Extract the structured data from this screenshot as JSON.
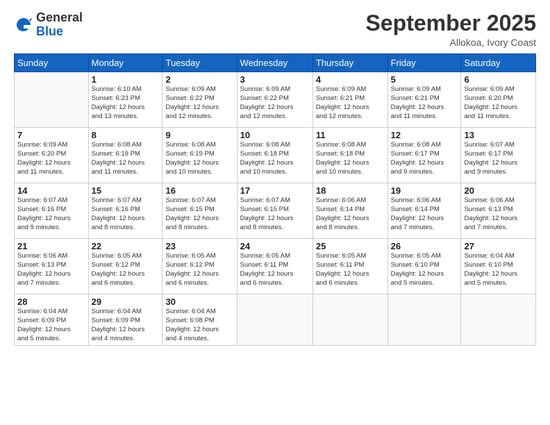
{
  "logo": {
    "general": "General",
    "blue": "Blue"
  },
  "title": "September 2025",
  "location": "Allokoa, Ivory Coast",
  "days_of_week": [
    "Sunday",
    "Monday",
    "Tuesday",
    "Wednesday",
    "Thursday",
    "Friday",
    "Saturday"
  ],
  "weeks": [
    [
      {
        "day": "",
        "info": ""
      },
      {
        "day": "1",
        "info": "Sunrise: 6:10 AM\nSunset: 6:23 PM\nDaylight: 12 hours\nand 13 minutes."
      },
      {
        "day": "2",
        "info": "Sunrise: 6:09 AM\nSunset: 6:22 PM\nDaylight: 12 hours\nand 12 minutes."
      },
      {
        "day": "3",
        "info": "Sunrise: 6:09 AM\nSunset: 6:22 PM\nDaylight: 12 hours\nand 12 minutes."
      },
      {
        "day": "4",
        "info": "Sunrise: 6:09 AM\nSunset: 6:21 PM\nDaylight: 12 hours\nand 12 minutes."
      },
      {
        "day": "5",
        "info": "Sunrise: 6:09 AM\nSunset: 6:21 PM\nDaylight: 12 hours\nand 11 minutes."
      },
      {
        "day": "6",
        "info": "Sunrise: 6:09 AM\nSunset: 6:20 PM\nDaylight: 12 hours\nand 11 minutes."
      }
    ],
    [
      {
        "day": "7",
        "info": "Sunrise: 6:09 AM\nSunset: 6:20 PM\nDaylight: 12 hours\nand 11 minutes."
      },
      {
        "day": "8",
        "info": "Sunrise: 6:08 AM\nSunset: 6:19 PM\nDaylight: 12 hours\nand 11 minutes."
      },
      {
        "day": "9",
        "info": "Sunrise: 6:08 AM\nSunset: 6:19 PM\nDaylight: 12 hours\nand 10 minutes."
      },
      {
        "day": "10",
        "info": "Sunrise: 6:08 AM\nSunset: 6:18 PM\nDaylight: 12 hours\nand 10 minutes."
      },
      {
        "day": "11",
        "info": "Sunrise: 6:08 AM\nSunset: 6:18 PM\nDaylight: 12 hours\nand 10 minutes."
      },
      {
        "day": "12",
        "info": "Sunrise: 6:08 AM\nSunset: 6:17 PM\nDaylight: 12 hours\nand 9 minutes."
      },
      {
        "day": "13",
        "info": "Sunrise: 6:07 AM\nSunset: 6:17 PM\nDaylight: 12 hours\nand 9 minutes."
      }
    ],
    [
      {
        "day": "14",
        "info": "Sunrise: 6:07 AM\nSunset: 6:16 PM\nDaylight: 12 hours\nand 9 minutes."
      },
      {
        "day": "15",
        "info": "Sunrise: 6:07 AM\nSunset: 6:16 PM\nDaylight: 12 hours\nand 8 minutes."
      },
      {
        "day": "16",
        "info": "Sunrise: 6:07 AM\nSunset: 6:15 PM\nDaylight: 12 hours\nand 8 minutes."
      },
      {
        "day": "17",
        "info": "Sunrise: 6:07 AM\nSunset: 6:15 PM\nDaylight: 12 hours\nand 8 minutes."
      },
      {
        "day": "18",
        "info": "Sunrise: 6:06 AM\nSunset: 6:14 PM\nDaylight: 12 hours\nand 8 minutes."
      },
      {
        "day": "19",
        "info": "Sunrise: 6:06 AM\nSunset: 6:14 PM\nDaylight: 12 hours\nand 7 minutes."
      },
      {
        "day": "20",
        "info": "Sunrise: 6:06 AM\nSunset: 6:13 PM\nDaylight: 12 hours\nand 7 minutes."
      }
    ],
    [
      {
        "day": "21",
        "info": "Sunrise: 6:06 AM\nSunset: 6:13 PM\nDaylight: 12 hours\nand 7 minutes."
      },
      {
        "day": "22",
        "info": "Sunrise: 6:05 AM\nSunset: 6:12 PM\nDaylight: 12 hours\nand 6 minutes."
      },
      {
        "day": "23",
        "info": "Sunrise: 6:05 AM\nSunset: 6:12 PM\nDaylight: 12 hours\nand 6 minutes."
      },
      {
        "day": "24",
        "info": "Sunrise: 6:05 AM\nSunset: 6:11 PM\nDaylight: 12 hours\nand 6 minutes."
      },
      {
        "day": "25",
        "info": "Sunrise: 6:05 AM\nSunset: 6:11 PM\nDaylight: 12 hours\nand 6 minutes."
      },
      {
        "day": "26",
        "info": "Sunrise: 6:05 AM\nSunset: 6:10 PM\nDaylight: 12 hours\nand 5 minutes."
      },
      {
        "day": "27",
        "info": "Sunrise: 6:04 AM\nSunset: 6:10 PM\nDaylight: 12 hours\nand 5 minutes."
      }
    ],
    [
      {
        "day": "28",
        "info": "Sunrise: 6:04 AM\nSunset: 6:09 PM\nDaylight: 12 hours\nand 5 minutes."
      },
      {
        "day": "29",
        "info": "Sunrise: 6:04 AM\nSunset: 6:09 PM\nDaylight: 12 hours\nand 4 minutes."
      },
      {
        "day": "30",
        "info": "Sunrise: 6:04 AM\nSunset: 6:08 PM\nDaylight: 12 hours\nand 4 minutes."
      },
      {
        "day": "",
        "info": ""
      },
      {
        "day": "",
        "info": ""
      },
      {
        "day": "",
        "info": ""
      },
      {
        "day": "",
        "info": ""
      }
    ]
  ]
}
